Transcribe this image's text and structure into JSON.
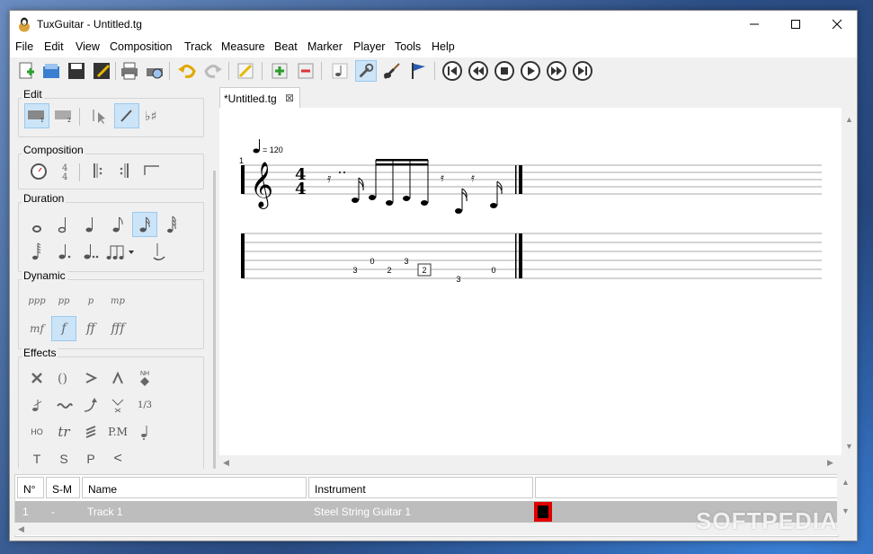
{
  "window": {
    "title": "TuxGuitar - Untitled.tg"
  },
  "menu": [
    "File",
    "Edit",
    "View",
    "Composition",
    "Track",
    "Measure",
    "Beat",
    "Marker",
    "Player",
    "Tools",
    "Help"
  ],
  "panel": {
    "edit_label": "Edit",
    "composition_label": "Composition",
    "duration_label": "Duration",
    "dynamic_label": "Dynamic",
    "effects_label": "Effects",
    "dynamics": [
      "ppp",
      "pp",
      "p",
      "mp",
      "mf",
      "f",
      "ff",
      "fff"
    ],
    "effect_text": {
      "nh": "NH",
      "tuplet": "1/3",
      "ho": "HO",
      "tr": "tr",
      "pm": "P.M",
      "t": "T",
      "s": "S",
      "p": "P",
      "lt": "<"
    }
  },
  "tab": {
    "label": "*Untitled.tg",
    "close": "⊠"
  },
  "score": {
    "tempo": "= 120",
    "measure_number": "1",
    "time_signature": {
      "top": "4",
      "bottom": "4"
    },
    "tab_numbers": [
      "3",
      "0",
      "2",
      "3",
      "2",
      "3",
      "0"
    ]
  },
  "tracks": {
    "headers": {
      "num": "N°",
      "sm": "S-M",
      "name": "Name",
      "instrument": "Instrument"
    },
    "rows": [
      {
        "num": "1",
        "sm": "-",
        "name": "Track 1",
        "instrument": "Steel String Guitar 1",
        "color": "#000000"
      }
    ]
  },
  "watermark": "SOFTPEDIA"
}
